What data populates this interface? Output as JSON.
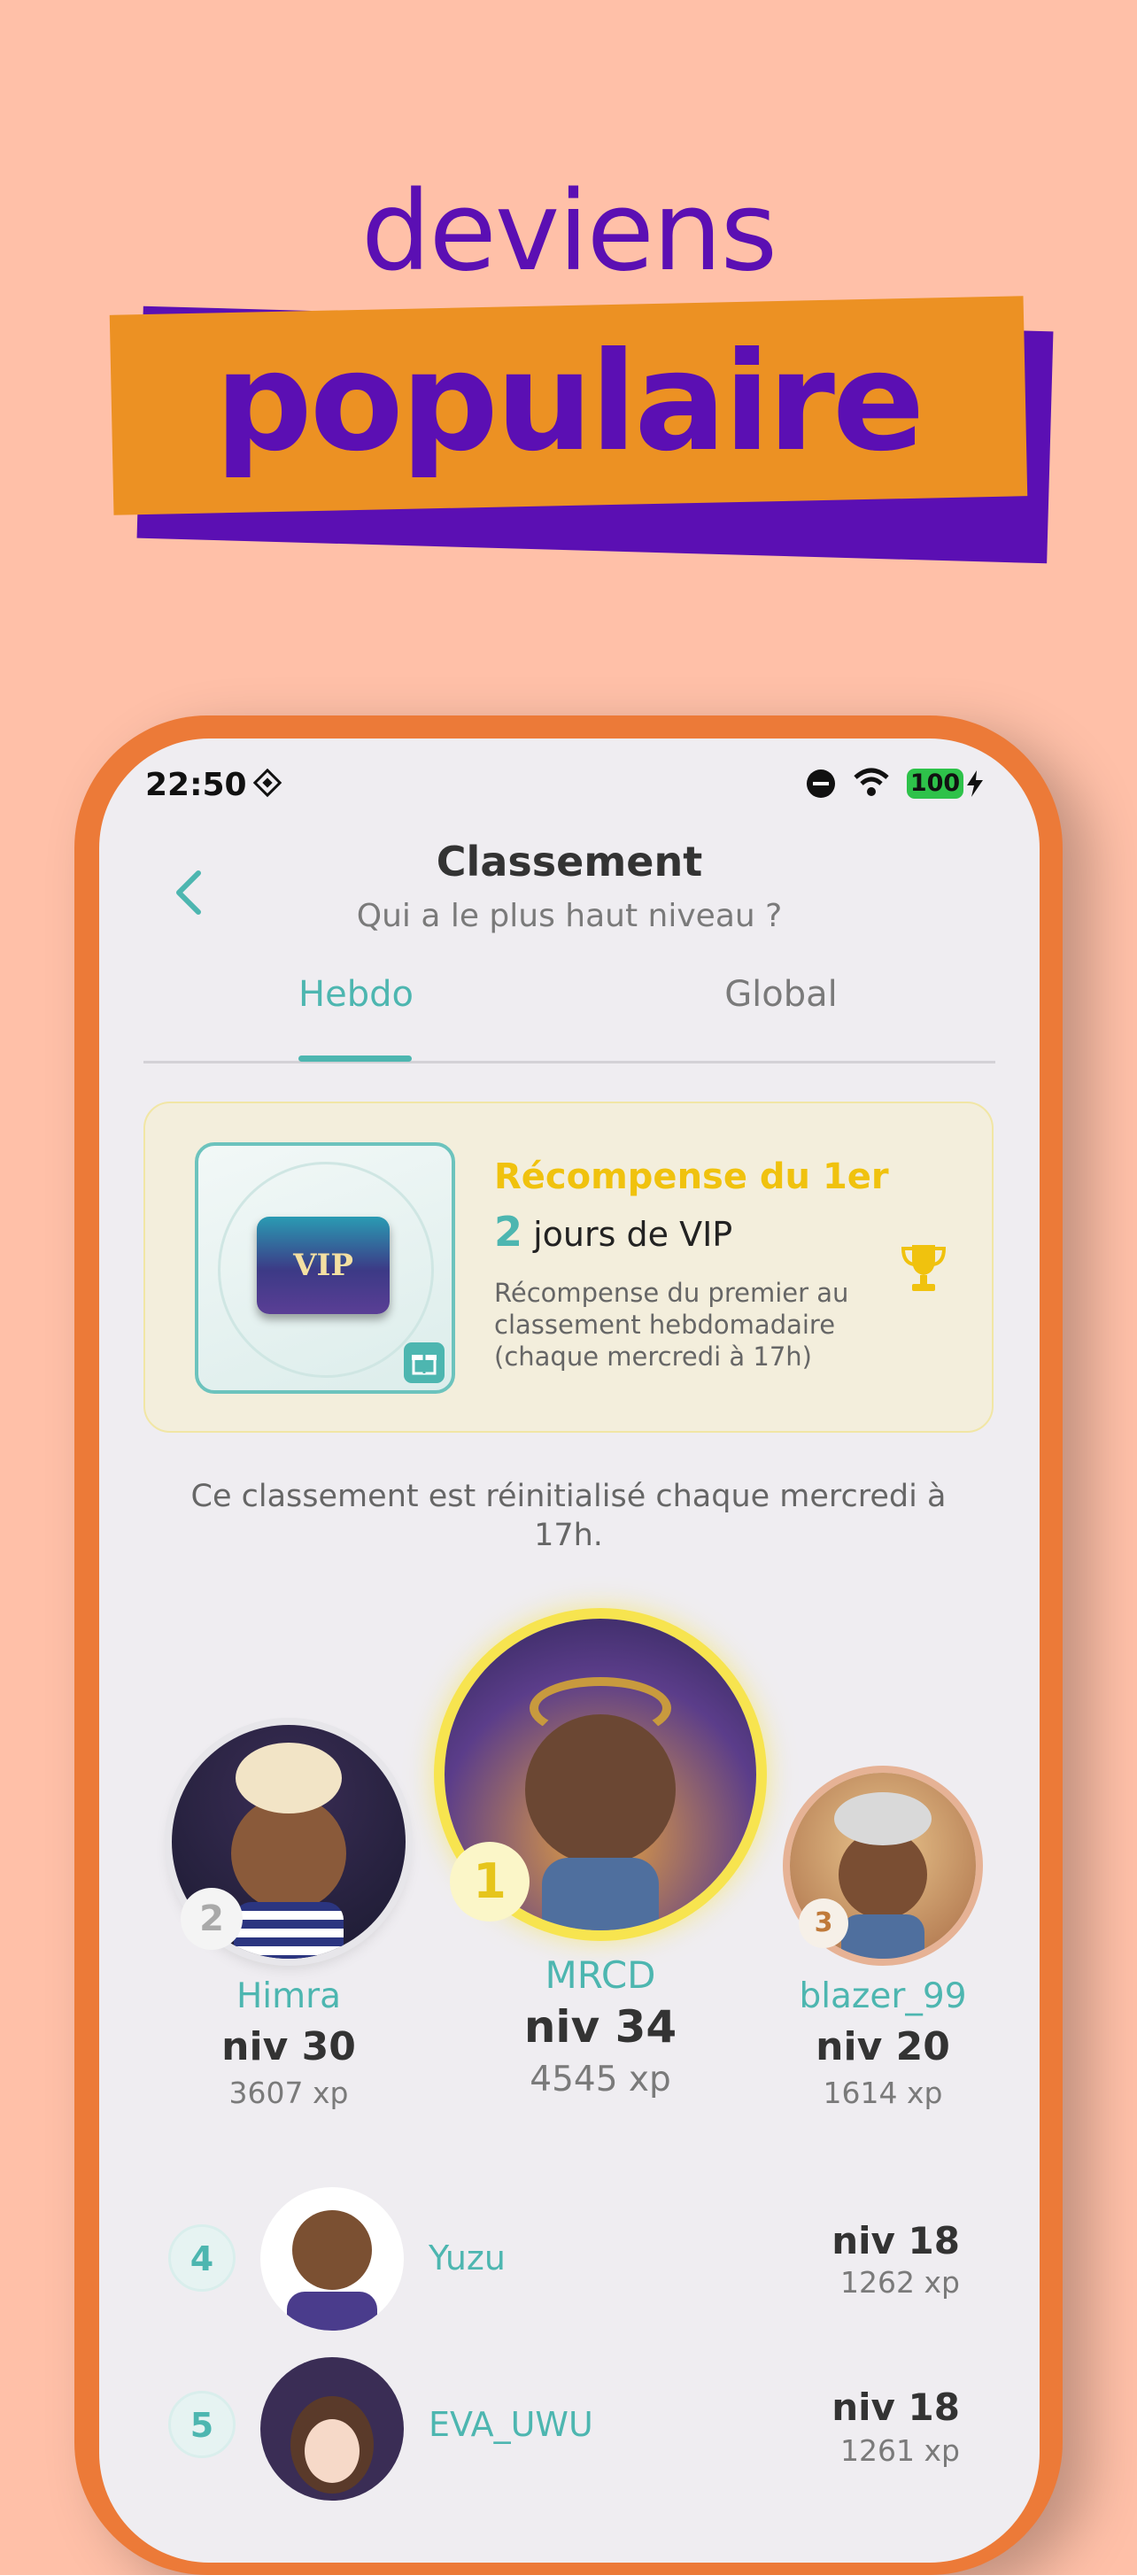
{
  "promo": {
    "headline_top": "deviens",
    "headline_banner": "populaire"
  },
  "status_bar": {
    "time": "22:50",
    "battery": "100"
  },
  "header": {
    "title": "Classement",
    "subtitle": "Qui a le plus haut niveau ?"
  },
  "tabs": [
    {
      "label": "Hebdo",
      "active": true
    },
    {
      "label": "Global",
      "active": false
    }
  ],
  "reward": {
    "title": "Récompense du 1er",
    "days_number": "2",
    "days_text": "jours de VIP",
    "description": "Récompense du premier au classement hebdomadaire (chaque mercredi à 17h)",
    "card_label": "VIP"
  },
  "reset_note": "Ce classement est réinitialisé chaque mercredi à 17h.",
  "podium": [
    {
      "rank": "2",
      "name": "Himra",
      "level": "niv 30",
      "xp": "3607 xp"
    },
    {
      "rank": "1",
      "name": "MRCD",
      "level": "niv 34",
      "xp": "4545 xp"
    },
    {
      "rank": "3",
      "name": "blazer_99",
      "level": "niv 20",
      "xp": "1614 xp"
    }
  ],
  "list": [
    {
      "rank": "4",
      "name": "Yuzu",
      "level": "niv 18",
      "xp": "1262 xp"
    },
    {
      "rank": "5",
      "name": "EVA_UWU",
      "level": "niv 18",
      "xp": "1261 xp"
    }
  ],
  "colors": {
    "background": "#FFC0A8",
    "purple": "#5B0FB3",
    "orange": "#EC9123",
    "phone_frame": "#EC7A38",
    "teal": "#4DB6B0",
    "gold": "#F0C20E"
  }
}
